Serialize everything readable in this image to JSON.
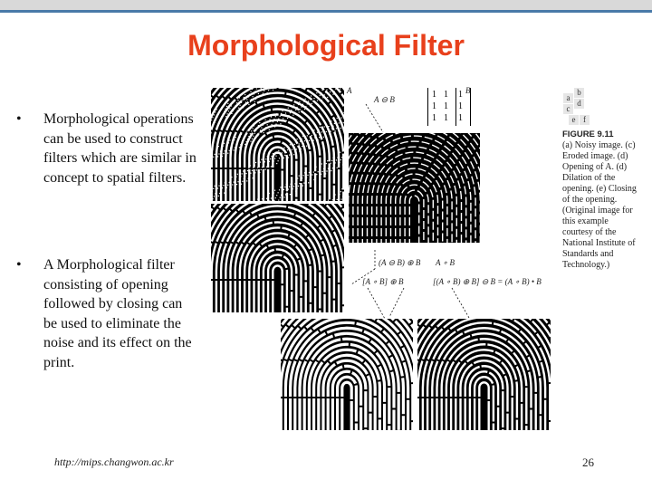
{
  "title": "Morphological Filter",
  "bullets": [
    {
      "icon": "bullet-dot-icon",
      "text": "Morphological operations can be used to construct filters which are similar in concept to spatial filters."
    },
    {
      "icon": "bullet-dot-icon",
      "text": "A Morphological filter consisting of opening followed by closing can be used to eliminate the noise and its effect on the print."
    }
  ],
  "figure": {
    "labels": {
      "a": "A",
      "b": "B",
      "erode": "A ⊖ B",
      "open_expr": "(A ⊖ B) ⊕ B",
      "open": "A ∘ B",
      "dil": "[A ∘ B] ⊕ B",
      "close": "[(A ∘ B) ⊕ B] ⊖ B = (A ∘ B) • B"
    },
    "matrix": [
      [
        "1",
        "1",
        "1"
      ],
      [
        "1",
        "1",
        "1"
      ],
      [
        "1",
        "1",
        "1"
      ]
    ],
    "panel_grid": [
      "a",
      "b",
      "c",
      "d",
      "e",
      "f"
    ],
    "caption_title": "FIGURE 9.11",
    "caption_text": "(a) Noisy image. (c) Eroded image. (d) Opening of A. (d) Dilation of the opening. (e) Closing of the opening. (Original image for this example courtesy of the National Institute of Standards and Technology.)"
  },
  "footer": {
    "url": "http://mips.changwon.ac.kr",
    "page": "26"
  }
}
